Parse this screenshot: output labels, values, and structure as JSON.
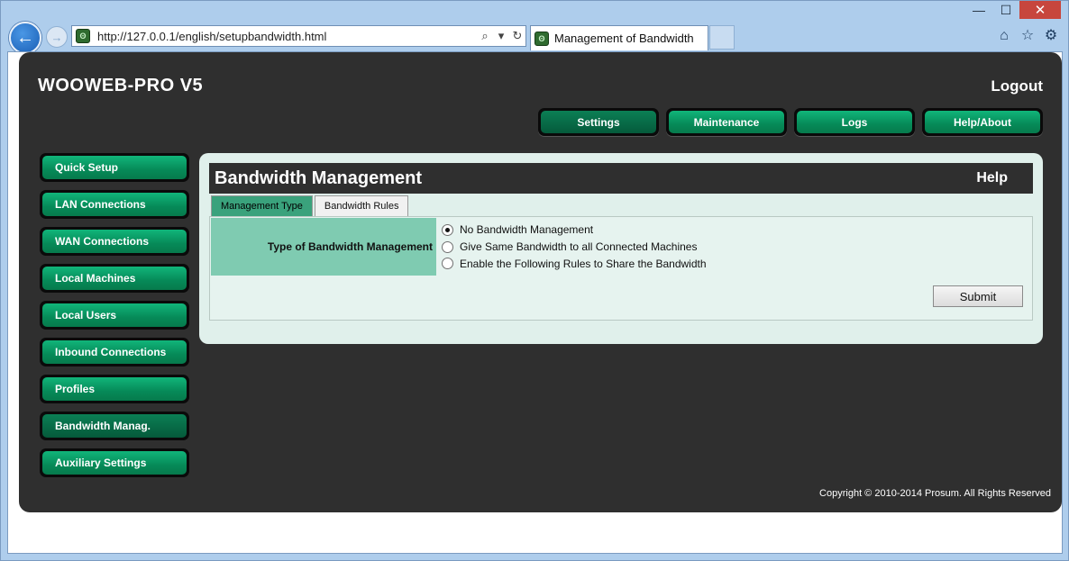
{
  "window": {
    "minimize": "—",
    "maximize": "☐",
    "close": "✕"
  },
  "browser": {
    "url": "http://127.0.0.1/english/setupbandwidth.html",
    "tab_title": "Management of Bandwidth",
    "favicon_text": "ʘ"
  },
  "app": {
    "brand": "WOOWEB-PRO V5",
    "logout": "Logout",
    "top_nav": [
      {
        "label": "Settings",
        "active": true
      },
      {
        "label": "Maintenance",
        "active": false
      },
      {
        "label": "Logs",
        "active": false
      },
      {
        "label": "Help/About",
        "active": false
      }
    ],
    "side_nav": [
      {
        "label": "Quick Setup",
        "active": false
      },
      {
        "label": "LAN Connections",
        "active": false
      },
      {
        "label": "WAN Connections",
        "active": false
      },
      {
        "label": "Local Machines",
        "active": false
      },
      {
        "label": "Local Users",
        "active": false
      },
      {
        "label": "Inbound Connections",
        "active": false
      },
      {
        "label": "Profiles",
        "active": false
      },
      {
        "label": "Bandwidth Manag.",
        "active": true
      },
      {
        "label": "Auxiliary Settings",
        "active": false
      }
    ],
    "content": {
      "title": "Bandwidth Management",
      "help": "Help",
      "tabs": [
        {
          "label": "Management Type",
          "active": true
        },
        {
          "label": "Bandwidth Rules",
          "active": false
        }
      ],
      "field_label": "Type of Bandwidth Management",
      "options": [
        {
          "label": "No Bandwidth Management",
          "checked": true
        },
        {
          "label": "Give Same Bandwidth to all Connected Machines",
          "checked": false
        },
        {
          "label": "Enable the Following Rules to Share the Bandwidth",
          "checked": false
        }
      ],
      "submit": "Submit"
    },
    "copyright": "Copyright © 2010-2014 Prosum. All Rights Reserved"
  }
}
